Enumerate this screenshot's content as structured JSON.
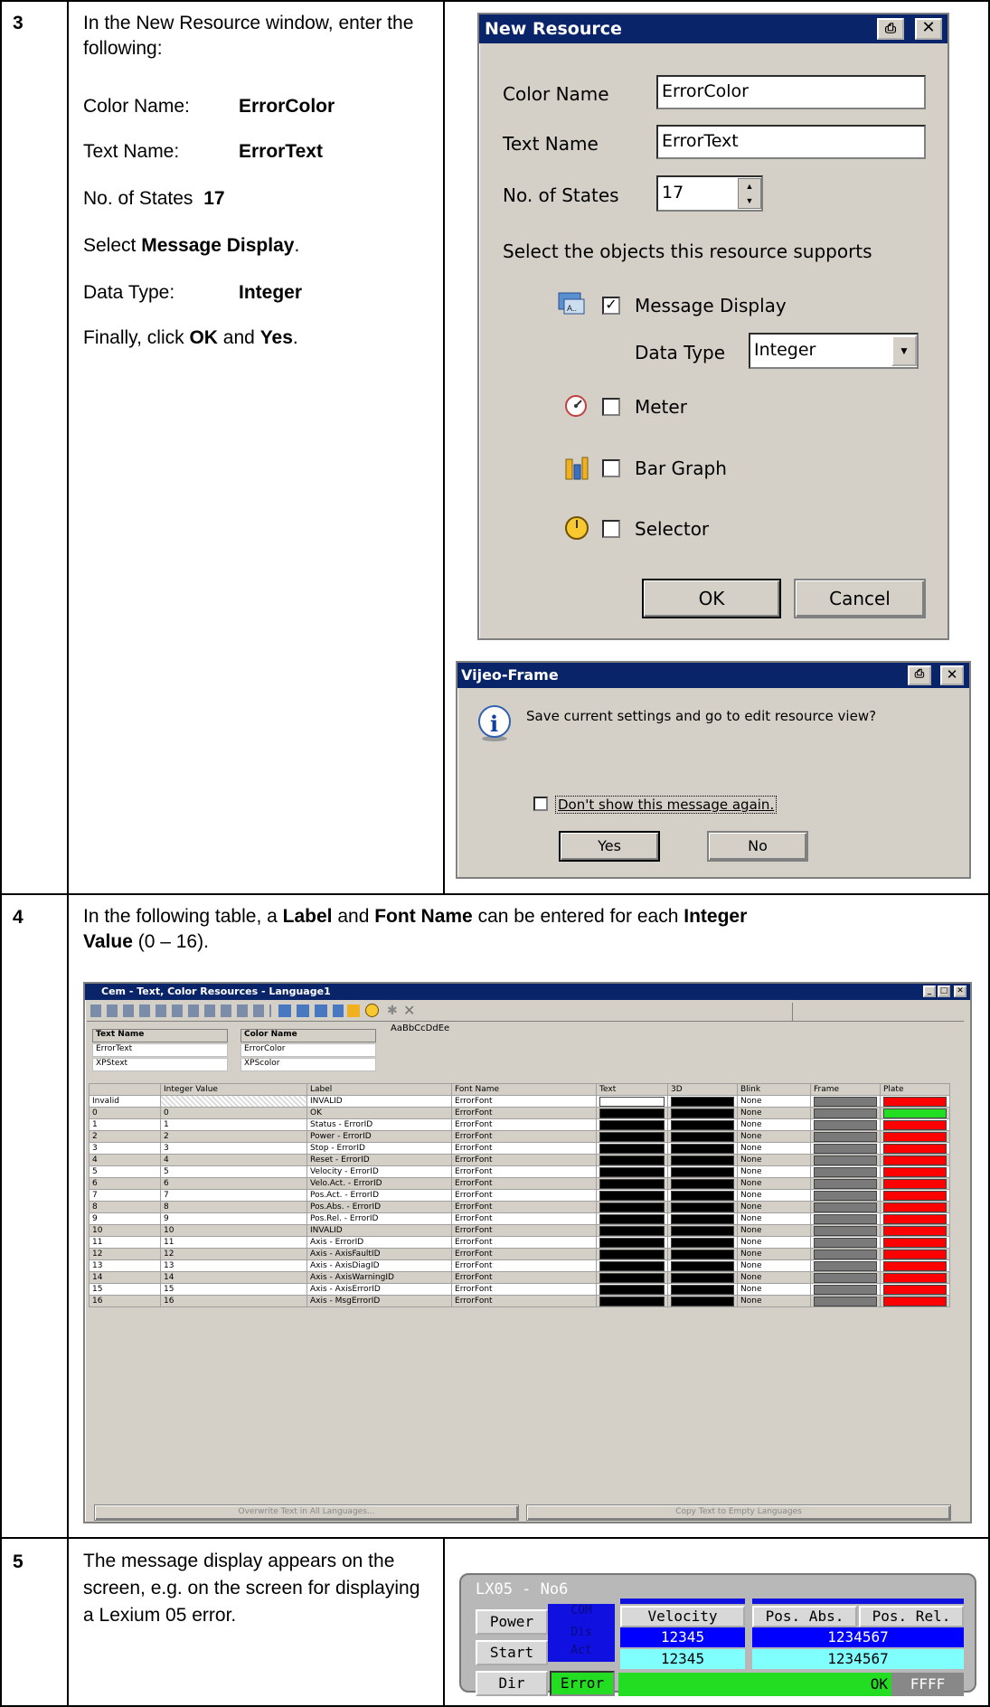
{
  "step3": {
    "number": "3",
    "intro": "In the New Resource window, enter the following:",
    "lines": [
      {
        "label": "Color Name:",
        "value": "ErrorColor"
      },
      {
        "label": "Text Name:",
        "value": "ErrorText"
      },
      {
        "label": "No. of States",
        "value": "17"
      }
    ],
    "select_prefix": "Select ",
    "select_value": "Message Display",
    "select_suffix": ".",
    "datatype_label": "Data Type:",
    "datatype_value": "Integer",
    "finally_prefix": "Finally, click ",
    "finally_ok": "OK",
    "finally_and": " and ",
    "finally_yes": "Yes",
    "finally_suffix": "."
  },
  "new_resource": {
    "title": "New Resource",
    "color_name_label": "Color Name",
    "color_name_value": "ErrorColor",
    "text_name_label": "Text Name",
    "text_name_value": "ErrorText",
    "states_label": "No. of States",
    "states_value": "17",
    "objects_heading": "Select the objects this resource supports",
    "message_display": "Message Display",
    "data_type_label": "Data Type",
    "data_type_value": "Integer",
    "meter": "Meter",
    "bar_graph": "Bar Graph",
    "selector": "Selector",
    "ok": "OK",
    "cancel": "Cancel"
  },
  "vijeo": {
    "title": "Vijeo-Frame",
    "message": "Save current settings and go to edit resource view?",
    "dont_show": "Don't show this message again.",
    "yes": "Yes",
    "no": "No"
  },
  "step4": {
    "number": "4",
    "t1": "In the following table, a ",
    "label": "Label",
    "t2": " and ",
    "font_name": "Font Name",
    "t3": " can be entered for each ",
    "integer": "Integer",
    "value": "Value",
    "t4": " (0 – 16)."
  },
  "cem": {
    "title": "Cem - Text, Color Resources - Language1",
    "text_name_header": "Text Name",
    "color_name_header": "Color Name",
    "sample": "AaBbCcDdEe",
    "text_names": [
      "ErrorText",
      "XPStext"
    ],
    "color_names": [
      "ErrorColor",
      "XPScolor"
    ],
    "columns": [
      "",
      "Integer Value",
      "Label",
      "Font Name",
      "Text",
      "3D",
      "Blink",
      "Frame",
      "Plate"
    ],
    "rows": [
      {
        "idx": "Invalid",
        "int": "",
        "label": "INVALID",
        "font": "ErrorFont",
        "text": "#ffffff",
        "blink": "None",
        "plate": "#ff0000"
      },
      {
        "idx": "0",
        "int": "0",
        "label": "OK",
        "font": "ErrorFont",
        "text": "#000000",
        "blink": "None",
        "plate": "#22dd22"
      },
      {
        "idx": "1",
        "int": "1",
        "label": "Status - ErrorID",
        "font": "ErrorFont",
        "text": "#000000",
        "blink": "None",
        "plate": "#ff0000"
      },
      {
        "idx": "2",
        "int": "2",
        "label": "Power - ErrorID",
        "font": "ErrorFont",
        "text": "#000000",
        "blink": "None",
        "plate": "#ff0000"
      },
      {
        "idx": "3",
        "int": "3",
        "label": "Stop - ErrorID",
        "font": "ErrorFont",
        "text": "#000000",
        "blink": "None",
        "plate": "#ff0000"
      },
      {
        "idx": "4",
        "int": "4",
        "label": "Reset - ErrorID",
        "font": "ErrorFont",
        "text": "#000000",
        "blink": "None",
        "plate": "#ff0000"
      },
      {
        "idx": "5",
        "int": "5",
        "label": "Velocity - ErrorID",
        "font": "ErrorFont",
        "text": "#000000",
        "blink": "None",
        "plate": "#ff0000"
      },
      {
        "idx": "6",
        "int": "6",
        "label": "Velo.Act. - ErrorID",
        "font": "ErrorFont",
        "text": "#000000",
        "blink": "None",
        "plate": "#ff0000"
      },
      {
        "idx": "7",
        "int": "7",
        "label": "Pos.Act. - ErrorID",
        "font": "ErrorFont",
        "text": "#000000",
        "blink": "None",
        "plate": "#ff0000"
      },
      {
        "idx": "8",
        "int": "8",
        "label": "Pos.Abs. - ErrorID",
        "font": "ErrorFont",
        "text": "#000000",
        "blink": "None",
        "plate": "#ff0000"
      },
      {
        "idx": "9",
        "int": "9",
        "label": "Pos.Rel. - ErrorID",
        "font": "ErrorFont",
        "text": "#000000",
        "blink": "None",
        "plate": "#ff0000"
      },
      {
        "idx": "10",
        "int": "10",
        "label": "INVALID",
        "font": "ErrorFont",
        "text": "#000000",
        "blink": "None",
        "plate": "#ff0000"
      },
      {
        "idx": "11",
        "int": "11",
        "label": "Axis - ErrorID",
        "font": "ErrorFont",
        "text": "#000000",
        "blink": "None",
        "plate": "#ff0000"
      },
      {
        "idx": "12",
        "int": "12",
        "label": "Axis - AxisFaultID",
        "font": "ErrorFont",
        "text": "#000000",
        "blink": "None",
        "plate": "#ff0000"
      },
      {
        "idx": "13",
        "int": "13",
        "label": "Axis - AxisDiagID",
        "font": "ErrorFont",
        "text": "#000000",
        "blink": "None",
        "plate": "#ff0000"
      },
      {
        "idx": "14",
        "int": "14",
        "label": "Axis - AxisWarningID",
        "font": "ErrorFont",
        "text": "#000000",
        "blink": "None",
        "plate": "#ff0000"
      },
      {
        "idx": "15",
        "int": "15",
        "label": "Axis - AxisErrorID",
        "font": "ErrorFont",
        "text": "#000000",
        "blink": "None",
        "plate": "#ff0000"
      },
      {
        "idx": "16",
        "int": "16",
        "label": "Axis - MsgErrorID",
        "font": "ErrorFont",
        "text": "#000000",
        "blink": "None",
        "plate": "#ff0000"
      }
    ],
    "overwrite_button": "Overwrite Text in All Languages...",
    "copy_button": "Copy Text to Empty Languages"
  },
  "step5": {
    "number": "5",
    "text": "The message display appears on the screen, e.g. on the screen for displaying a Lexium 05 error."
  },
  "lx": {
    "title": "LX05 - No6",
    "power": "Power",
    "start": "Start",
    "dir": "Dir",
    "com": "COM",
    "dis": "Dis",
    "act": "Act",
    "velocity": "Velocity",
    "vel1": "12345",
    "vel2": "12345",
    "pos_abs": "Pos. Abs.",
    "pos_rel": "Pos. Rel.",
    "pos1": "1234567",
    "pos2": "1234567",
    "error": "Error",
    "ok": "OK",
    "ffff": "FFFF"
  }
}
